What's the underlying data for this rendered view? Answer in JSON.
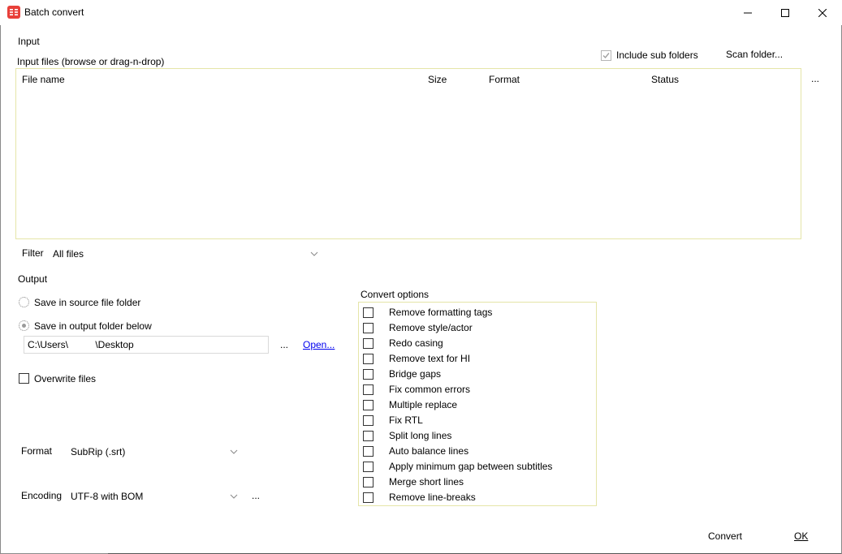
{
  "window": {
    "title": "Batch convert",
    "minimize": "minimize",
    "maximize": "maximize",
    "close": "close"
  },
  "input": {
    "section_label": "Input",
    "files_label": "Input files (browse or drag-n-drop)",
    "include_sub_folders_label": "Include sub folders",
    "include_sub_folders_checked": true,
    "scan_folder_label": "Scan folder...",
    "browse_label": "...",
    "columns": [
      "File name",
      "Size",
      "Format",
      "Status"
    ],
    "rows": []
  },
  "filter": {
    "label": "Filter",
    "value": "All files"
  },
  "output": {
    "section_label": "Output",
    "save_source_label": "Save in source file folder",
    "save_output_label": "Save in output folder below",
    "folder_value": "C:\\Users\\          \\Desktop",
    "browse_label": "...",
    "open_label": "Open...",
    "overwrite_label": "Overwrite files",
    "overwrite_checked": false
  },
  "format": {
    "label": "Format",
    "value": "SubRip (.srt)"
  },
  "encoding": {
    "label": "Encoding",
    "value": "UTF-8 with BOM",
    "more_label": "..."
  },
  "convert_options": {
    "label": "Convert options",
    "items": [
      "Remove formatting tags",
      "Remove style/actor",
      "Redo casing",
      "Remove text for HI",
      "Bridge gaps",
      "Fix common errors",
      "Multiple replace",
      "Fix RTL",
      "Split long lines",
      "Auto balance lines",
      "Apply minimum gap between subtitles",
      "Merge short lines",
      "Remove line-breaks"
    ]
  },
  "buttons": {
    "convert": "Convert",
    "ok": "OK"
  },
  "colors": {
    "app_icon": "#e8403a",
    "group_border": "#e5e5a8",
    "link": "#0000ee"
  }
}
